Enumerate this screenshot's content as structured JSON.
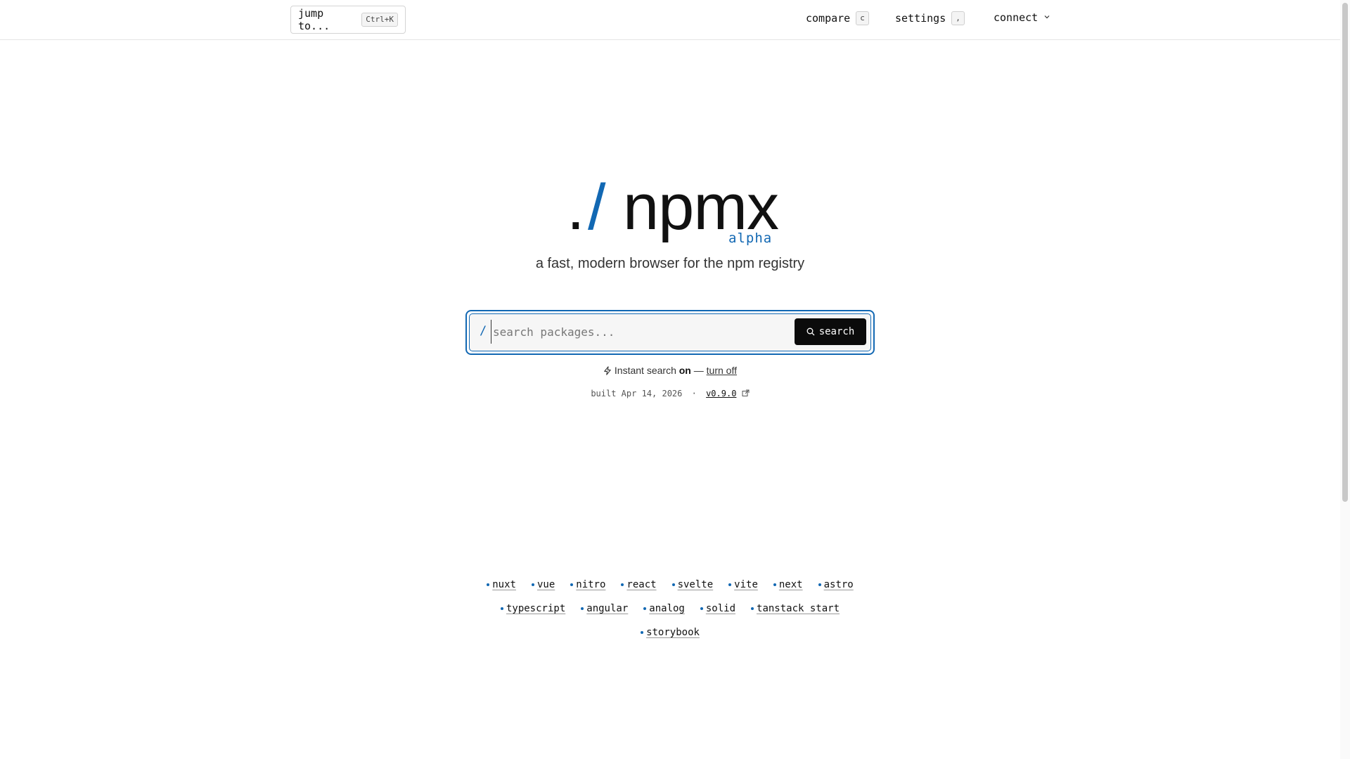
{
  "header": {
    "jump": {
      "label": "jump to...",
      "shortcut": "Ctrl+K"
    },
    "nav": [
      {
        "label": "compare",
        "shortcut": "c"
      },
      {
        "label": "settings",
        "shortcut": ","
      },
      {
        "label": "connect"
      }
    ]
  },
  "logo": {
    "dot": ".",
    "slash": "/",
    "word": "npmx",
    "badge": "alpha"
  },
  "tagline": "a fast, modern browser for the npm registry",
  "search": {
    "prefix": "/",
    "placeholder": "search packages...",
    "button_label": "search"
  },
  "instant": {
    "prefix": "Instant search",
    "state": "on",
    "separator": "—",
    "toggle_label": "turn off"
  },
  "build": {
    "text": "built Apr 14, 2026",
    "sep": "·",
    "version": "v0.9.0"
  },
  "frameworks": {
    "row1": [
      "nuxt",
      "vue",
      "nitro",
      "react",
      "svelte",
      "vite",
      "next",
      "astro"
    ],
    "row2": [
      "typescript",
      "angular",
      "analog",
      "solid",
      "tanstack start"
    ],
    "row3": [
      "storybook"
    ]
  },
  "colors": {
    "accent": "#1268b3",
    "button": "#0b0b0b"
  }
}
